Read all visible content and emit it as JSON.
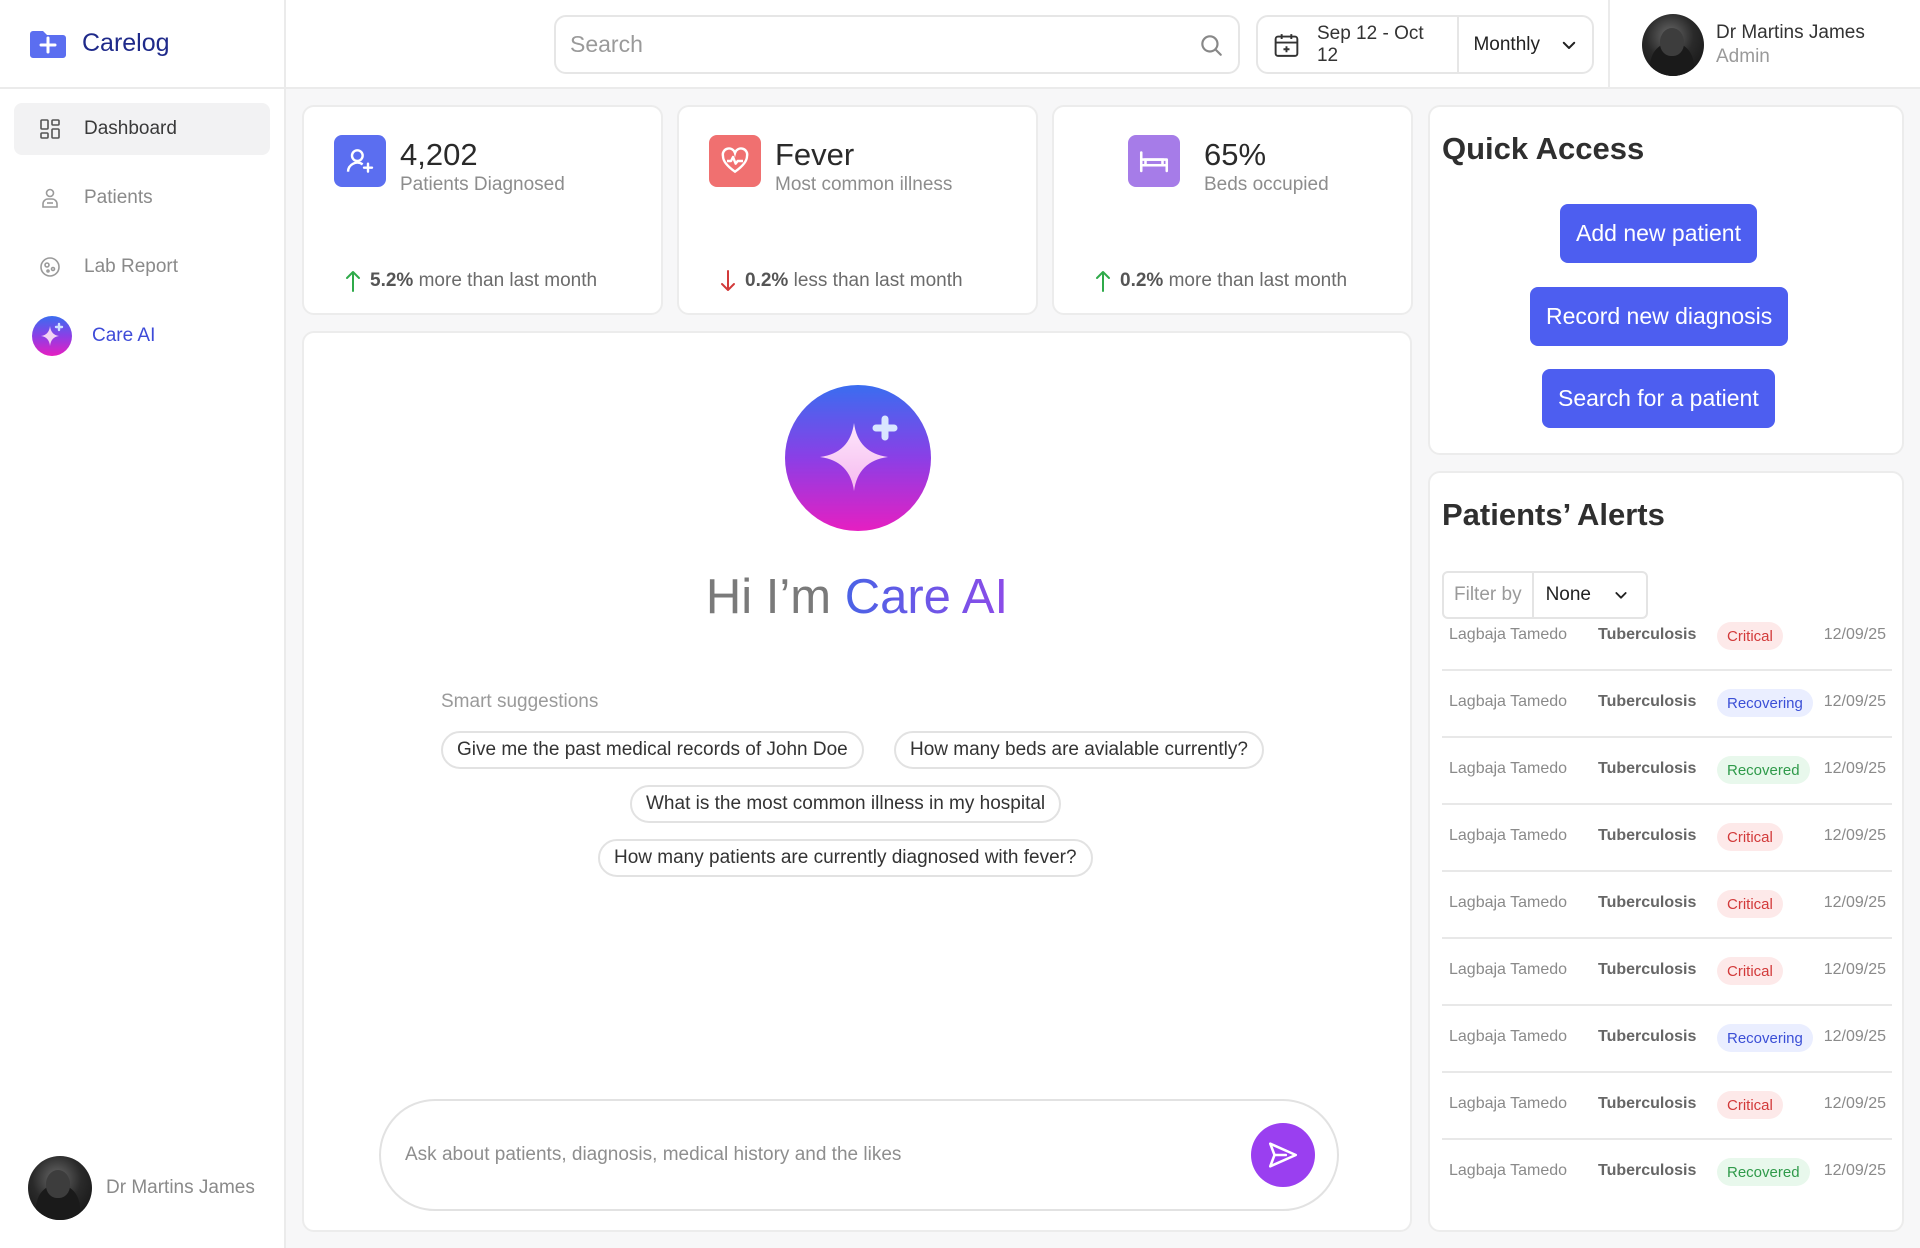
{
  "brand": {
    "name": "Carelog"
  },
  "sidebar": {
    "items": [
      {
        "label": "Dashboard",
        "icon": "grid-icon"
      },
      {
        "label": "Patients",
        "icon": "patient-icon"
      },
      {
        "label": "Lab Report",
        "icon": "lab-icon"
      },
      {
        "label": "Care AI",
        "icon": "sparkle-icon"
      }
    ],
    "user_name": "Dr Martins James"
  },
  "topbar": {
    "search_placeholder": "Search",
    "date_range": "Sep 12 - Oct 12",
    "period": "Monthly",
    "user_name": "Dr Martins James",
    "user_role": "Admin"
  },
  "stats": [
    {
      "value": "4,202",
      "label": "Patients Diagnosed",
      "trend_value": "5.2%",
      "trend_text": "more than last month",
      "direction": "up",
      "icon": "user-add-icon",
      "color": "#5b6ef0"
    },
    {
      "value": "Fever",
      "label": "Most common illness",
      "trend_value": "0.2%",
      "trend_text": "less than last month",
      "direction": "down",
      "icon": "heart-pulse-icon",
      "color": "#f07070"
    },
    {
      "value": "65%",
      "label": "Beds occupied",
      "trend_value": "0.2%",
      "trend_text": "more than last month",
      "direction": "up",
      "icon": "bed-icon",
      "color": "#a67ce8"
    }
  ],
  "ai": {
    "greeting": "Hi I’m ",
    "name": "Care AI",
    "suggestions_label": "Smart suggestions",
    "suggestions": [
      "Give me the past medical records of John Doe",
      "How many beds are avialable currently?",
      "What is the most common illness in my hospital",
      "How many patients are currently diagnosed with fever?"
    ],
    "input_placeholder": "Ask about patients, diagnosis, medical history and the likes"
  },
  "quick_access": {
    "title": "Quick Access",
    "buttons": [
      "Add new patient",
      "Record new diagnosis",
      "Search for a patient"
    ]
  },
  "alerts": {
    "title": "Patients’ Alerts",
    "filter_label": "Filter by",
    "filter_value": "None",
    "rows": [
      {
        "name": "Lagbaja Tamedo",
        "condition": "Tuberculosis",
        "status": "Critical",
        "date": "12/09/25"
      },
      {
        "name": "Lagbaja Tamedo",
        "condition": "Tuberculosis",
        "status": "Recovering",
        "date": "12/09/25"
      },
      {
        "name": "Lagbaja Tamedo",
        "condition": "Tuberculosis",
        "status": "Recovered",
        "date": "12/09/25"
      },
      {
        "name": "Lagbaja Tamedo",
        "condition": "Tuberculosis",
        "status": "Critical",
        "date": "12/09/25"
      },
      {
        "name": "Lagbaja Tamedo",
        "condition": "Tuberculosis",
        "status": "Critical",
        "date": "12/09/25"
      },
      {
        "name": "Lagbaja Tamedo",
        "condition": "Tuberculosis",
        "status": "Critical",
        "date": "12/09/25"
      },
      {
        "name": "Lagbaja Tamedo",
        "condition": "Tuberculosis",
        "status": "Recovering",
        "date": "12/09/25"
      },
      {
        "name": "Lagbaja Tamedo",
        "condition": "Tuberculosis",
        "status": "Critical",
        "date": "12/09/25"
      },
      {
        "name": "Lagbaja Tamedo",
        "condition": "Tuberculosis",
        "status": "Recovered",
        "date": "12/09/25"
      }
    ]
  },
  "colors": {
    "accent": "#4d5ef0",
    "ai_purple": "#9a3ff0",
    "up": "#2faa4a",
    "down": "#d23a3a"
  }
}
